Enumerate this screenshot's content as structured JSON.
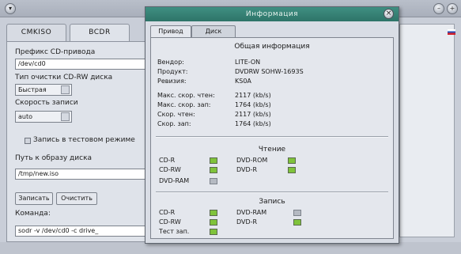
{
  "main": {
    "tabs": [
      "CMKISO",
      "BCDR"
    ],
    "fields": {
      "prefix_label": "Префикс CD-привода",
      "prefix_value": "/dev/cd0",
      "erase_label": "Тип очистки CD-RW диска",
      "erase_value": "Быстрая",
      "speed_label": "Скорость записи",
      "speed_value": "auto",
      "test_label": "Запись в тестовом режиме",
      "path_label": "Путь к образу диска",
      "path_value": "/tmp/new.iso",
      "write_button": "Записать",
      "clear_button": "Очистить",
      "command_label": "Команда:",
      "command_value": "sodr -v /dev/cd0 -c drive_"
    }
  },
  "dialog": {
    "title": "Информация",
    "tabs": [
      "Привод",
      "Диск"
    ],
    "general": {
      "heading": "Общая информация",
      "rows": [
        {
          "k": "Вендор:",
          "v": "LITE-ON"
        },
        {
          "k": "Продукт:",
          "v": "DVDRW SOHW-1693S"
        },
        {
          "k": "Ревизия:",
          "v": "KS0A"
        },
        {
          "k": "Макс. скор. чтен:",
          "v": "2117 (kb/s)"
        },
        {
          "k": "Макс. скор. зап:",
          "v": "1764 (kb/s)"
        },
        {
          "k": "Скор. чтен:",
          "v": "2117 (kb/s)"
        },
        {
          "k": "Скор. зап:",
          "v": "1764 (kb/s)"
        }
      ]
    },
    "read": {
      "heading": "Чтение",
      "items": [
        {
          "label": "CD-R",
          "on": true
        },
        {
          "label": "DVD-ROM",
          "on": true
        },
        {
          "label": "CD-RW",
          "on": true
        },
        {
          "label": "DVD-R",
          "on": true
        },
        {
          "label": "DVD-RAM",
          "on": false
        }
      ]
    },
    "write": {
      "heading": "Запись",
      "items": [
        {
          "label": "CD-R",
          "on": true
        },
        {
          "label": "DVD-RAM",
          "on": false
        },
        {
          "label": "CD-RW",
          "on": true
        },
        {
          "label": "DVD-R",
          "on": true
        },
        {
          "label": "Тест зап.",
          "on": true
        }
      ]
    }
  },
  "colors": {
    "title_bar": "#2e7468",
    "led_on": "#7fc33b",
    "led_off": "#b5bac2"
  }
}
